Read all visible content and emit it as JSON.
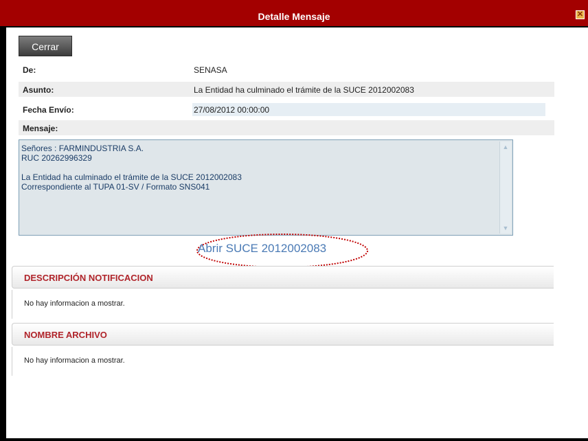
{
  "window": {
    "title": "Detalle Mensaje",
    "close_glyph": "✕"
  },
  "actions": {
    "close_label": "Cerrar"
  },
  "fields": {
    "de_label": "De:",
    "de_value": "SENASA",
    "asunto_label": "Asunto:",
    "asunto_value": "La Entidad ha culminado el trámite de la SUCE 2012002083",
    "fecha_label": "Fecha Envío:",
    "fecha_value": "27/08/2012 00:00:00",
    "mensaje_label": "Mensaje:"
  },
  "message": {
    "body": "Señores : FARMINDUSTRIA S.A.\nRUC 20262996329\n\nLa Entidad ha culminado el trámite de la SUCE 2012002083\nCorrespondiente al TUPA 01-SV / Formato SNS041"
  },
  "open_link": "Abrir SUCE 2012002083",
  "sections": [
    {
      "title": "DESCRIPCIÓN NOTIFICACION",
      "empty_text": "No hay informacion a mostrar."
    },
    {
      "title": "NOMBRE ARCHIVO",
      "empty_text": "No hay informacion a mostrar."
    }
  ],
  "colors": {
    "title_bar": "#a30000",
    "section_title": "#b0242a",
    "link": "#4a7ab5"
  }
}
